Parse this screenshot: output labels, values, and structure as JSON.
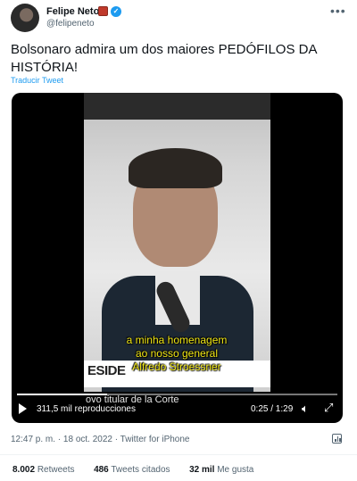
{
  "author": {
    "name": "Felipe Neto",
    "handle": "@felipeneto"
  },
  "tweet": {
    "text": "Bolsonaro admira um dos maiores PEDÓFILOS DA HISTÓRIA!",
    "translate_label": "Traducir Tweet",
    "timestamp": "12:47 p. m. · 18 oct. 2022 · Twitter for iPhone"
  },
  "video": {
    "captions": [
      "a minha homenagem",
      "ao nosso general",
      "Alfredo Stroessner"
    ],
    "lower_third": "ESIDE",
    "subtitle": "ovo titular de la Corte",
    "views": "311,5 mil reproducciones",
    "time": "0:25 / 1:29",
    "progress": 0.28
  },
  "stats": {
    "retweets_count": "8.002",
    "retweets_label": "Retweets",
    "quotes_count": "486",
    "quotes_label": "Tweets citados",
    "likes_count": "32 mil",
    "likes_label": "Me gusta"
  },
  "icons": {
    "more": "more-horizontal-icon",
    "play": "play-icon",
    "volume": "volume-icon",
    "fullscreen": "fullscreen-icon",
    "analytics": "analytics-icon"
  },
  "colors": {
    "accent": "#1d9bf0",
    "caption": "#f0e614",
    "secondary_text": "#536471"
  }
}
